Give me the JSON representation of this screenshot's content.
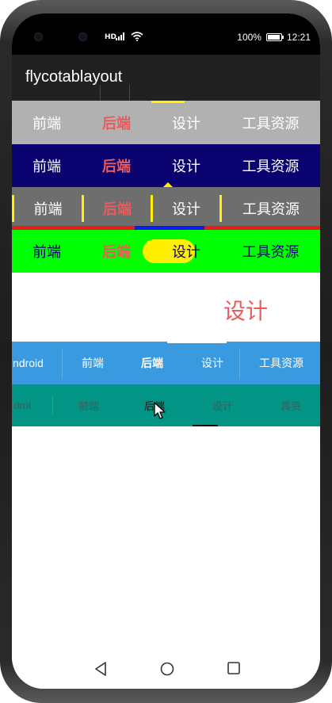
{
  "status_bar": {
    "left_icons": [
      "hd-icon",
      "signal-icon",
      "wifi-icon"
    ],
    "hd_label": "HD",
    "battery": "100%",
    "time": "12:21"
  },
  "app": {
    "title": "flycotablayout"
  },
  "tab_sets": {
    "basic": [
      "前端",
      "后端",
      "设计",
      "工具资源"
    ],
    "scroll": [
      "ndroid",
      "前端",
      "后端",
      "设计",
      "工具资源"
    ],
    "scroll2": [
      "droi",
      "前端",
      "后端",
      "设计",
      "具资"
    ]
  },
  "big_label": "设计",
  "colors": {
    "gray_bar": "#b1b1b1",
    "navy_bar": "#0a0370",
    "dark_gray_bar": "#6e6e6e",
    "green_bar": "#00ff00",
    "blue_bar": "#3a9ae0",
    "teal_bar": "#029485",
    "selected_red": "#ea5b5b",
    "indicator_yellow": "#ffef00",
    "indicator_blue": "#0d1bef",
    "underline_red": "#e81a1a"
  }
}
